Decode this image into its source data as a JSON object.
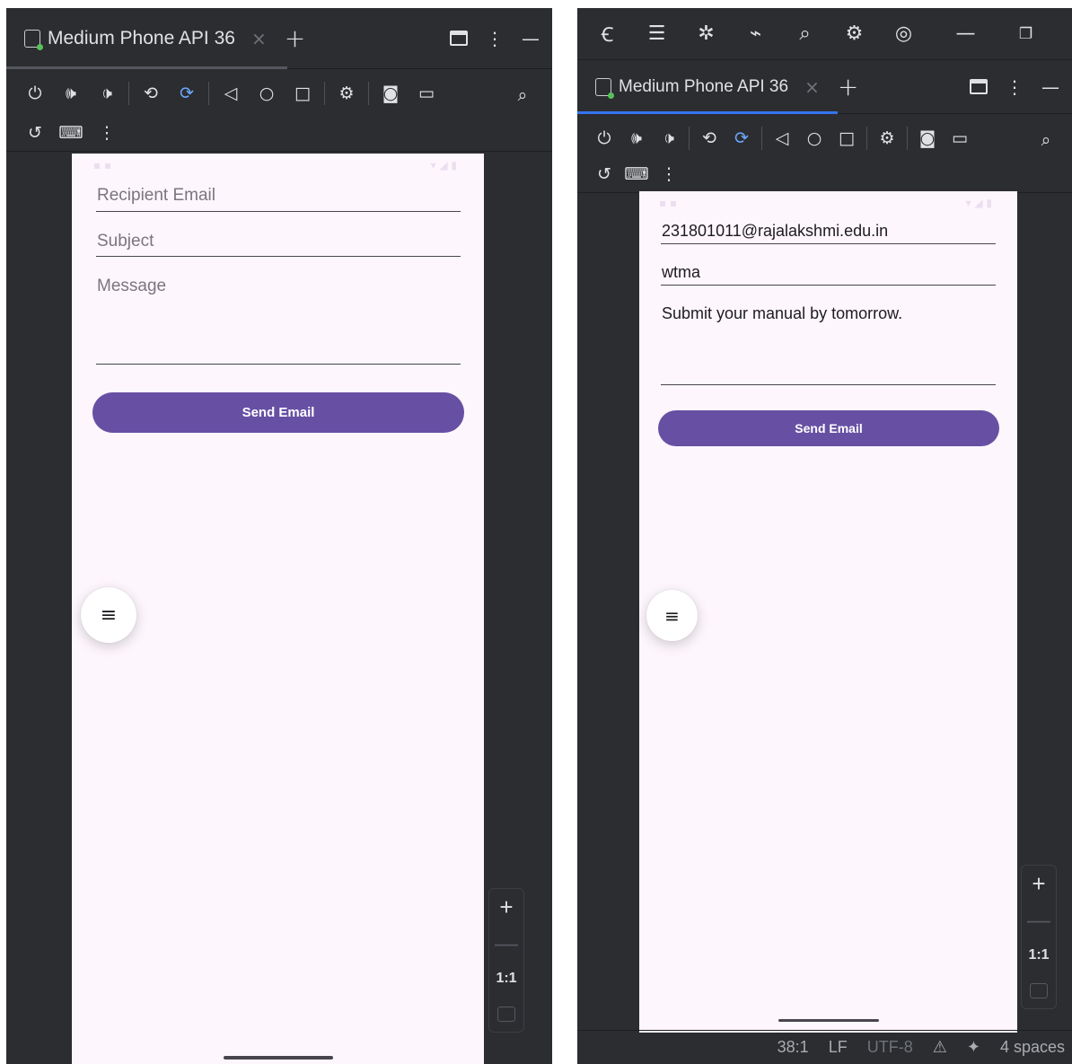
{
  "accent": "#6750a4",
  "tab_indicator_color": "#3574f0",
  "left": {
    "tab": {
      "title": "Medium Phone API 36",
      "close": "×",
      "plus": "+"
    },
    "app": {
      "recipient_placeholder": "Recipient Email",
      "subject_placeholder": "Subject",
      "message_placeholder": "Message",
      "send_label": "Send Email"
    },
    "zoom": {
      "plus": "+",
      "minus": "—",
      "one_to_one": "1:1"
    }
  },
  "right": {
    "tab": {
      "title": "Medium Phone API 36",
      "close": "×",
      "plus": "+"
    },
    "app": {
      "recipient_value": "231801011@rajalakshmi.edu.in",
      "subject_value": "wtma",
      "message_value": "Submit your manual by tomorrow.",
      "send_label": "Send Email"
    },
    "zoom": {
      "plus": "+",
      "minus": "—",
      "one_to_one": "1:1"
    },
    "status": {
      "position": "38:1",
      "line_ending": "LF",
      "encoding": "UTF-8",
      "indent": "4 spaces"
    }
  },
  "icons": {
    "power": "⏻",
    "volume_up": "🕪",
    "volume_down": "🕩",
    "back": "◁",
    "home": "○",
    "overview": "□",
    "more": "⋮",
    "menu": "≡",
    "minimize": "—",
    "search": "⌕"
  }
}
